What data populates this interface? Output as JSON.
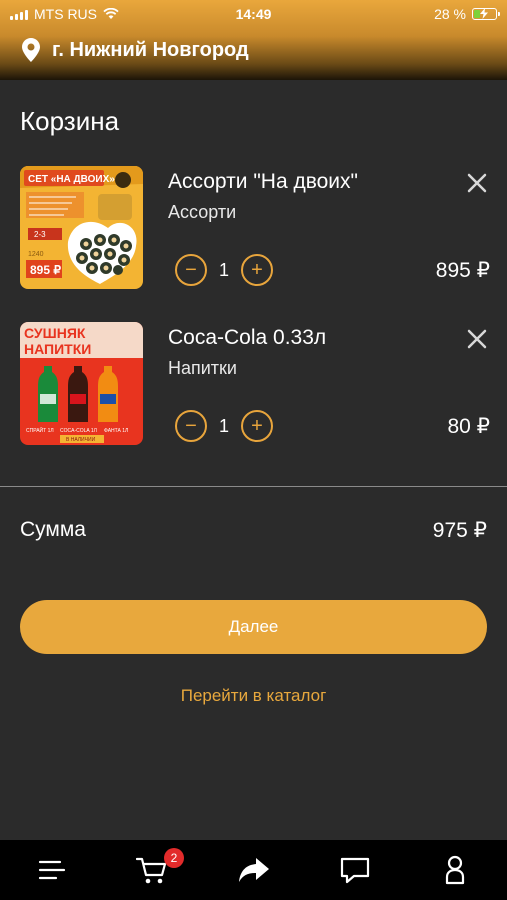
{
  "status_bar": {
    "carrier": "MTS RUS",
    "time": "14:49",
    "battery_percent": "28 %",
    "battery_level": 0.28
  },
  "header": {
    "location": "г. Нижний Новгород"
  },
  "page": {
    "title": "Корзина"
  },
  "cart": {
    "items": [
      {
        "name": "Ассорти \"На двоих\"",
        "category": "Ассорти",
        "quantity": "1",
        "price": "895 ₽",
        "image": {
          "banner": "СЕТ «НА ДВОИХ»",
          "weight": "1240",
          "price": "895 ₽",
          "badge": "2-3"
        }
      },
      {
        "name": "Coca-Cola 0.33л",
        "category": "Напитки",
        "quantity": "1",
        "price": "80 ₽",
        "image": {
          "title_line1": "СУШНЯК",
          "title_line2": "НАПИТКИ",
          "labels": [
            "СПРАЙТ 1Л",
            "COCA-COLA 1Л",
            "ФАНТА 1Л"
          ],
          "caption": "В НАЛИЧИИ"
        }
      }
    ],
    "minus_symbol": "−",
    "plus_symbol": "+"
  },
  "summary": {
    "label": "Сумма",
    "value": "975 ₽"
  },
  "actions": {
    "next_label": "Далее",
    "catalog_link": "Перейти в каталог"
  },
  "tabbar": {
    "cart_badge": "2"
  },
  "colors": {
    "accent": "#e8a83d",
    "background": "#2b2b2b",
    "tabbar": "#000000",
    "badge": "#e22b2b"
  }
}
